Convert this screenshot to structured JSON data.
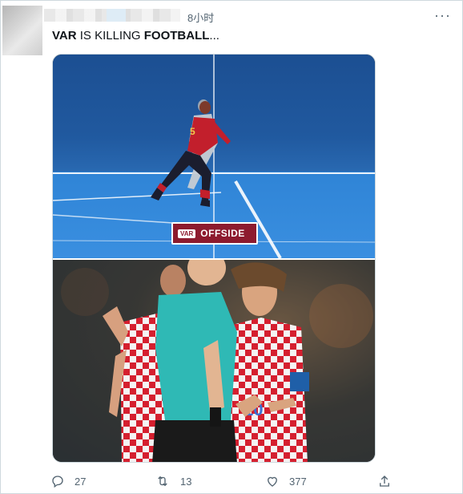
{
  "header": {
    "timestamp": "8小时"
  },
  "tweet": {
    "text_part1": "VAR",
    "text_part2": " IS KILLING ",
    "text_part3": "FOOTBALL",
    "text_part4": "..."
  },
  "media": {
    "top_image": {
      "badge_chip": "VAR",
      "badge_text": "OFFSIDE",
      "shirt_number": "5"
    },
    "bottom_image": {
      "shirt_number": "10"
    }
  },
  "actions": {
    "reply_count": "27",
    "retweet_count": "13",
    "like_count": "377"
  },
  "colors": {
    "accent_text": "#536471",
    "border": "#cfd9de",
    "badge_red": "#8d1b2e",
    "pitch_blue": "#2f84d6"
  },
  "icons": [
    "more-icon",
    "reply-icon",
    "retweet-icon",
    "like-icon",
    "share-icon"
  ]
}
